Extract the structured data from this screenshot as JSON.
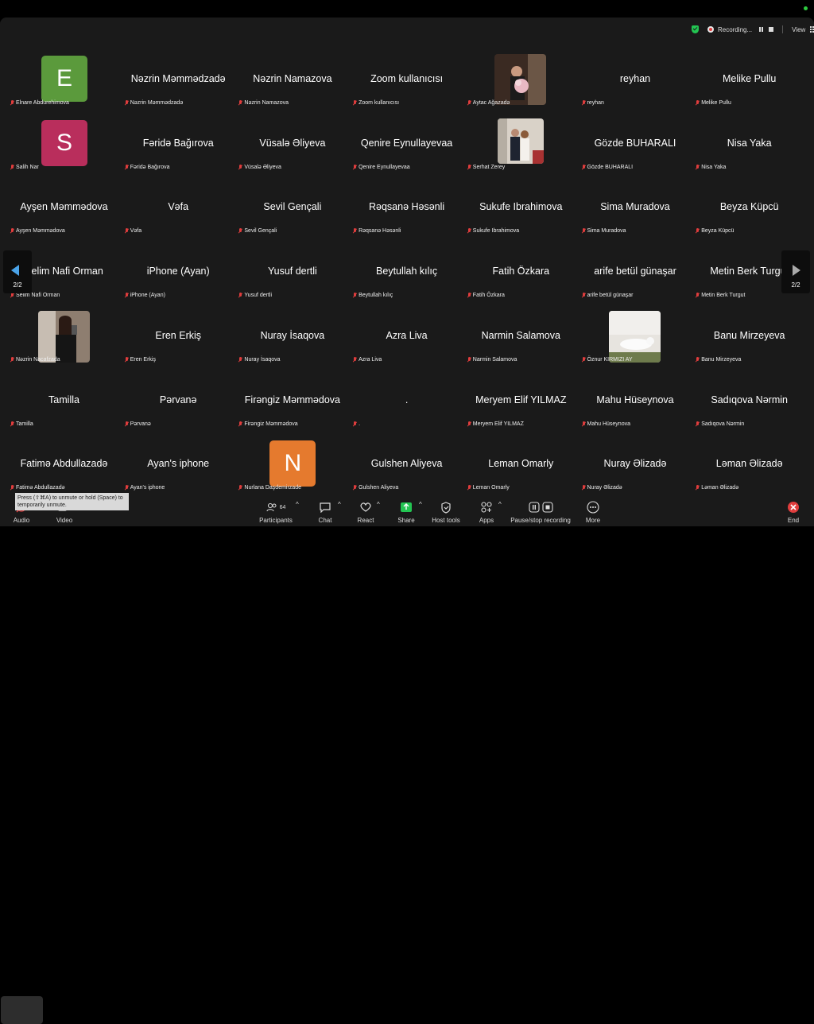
{
  "status": {
    "recording_label": "Recording...",
    "view_label": "View"
  },
  "gallery": {
    "rows": [
      [
        {
          "display": "",
          "tag": "Elnare Abdurehimova",
          "avatar": {
            "kind": "letter",
            "letter": "E",
            "color": "#5b9a3c"
          }
        },
        {
          "display": "Nəzrin Məmmədzadə",
          "tag": "Nəzrin Məmmədzadə"
        },
        {
          "display": "Nəzrin Namazova",
          "tag": "Nəzrin Namazova"
        },
        {
          "display": "Zoom kullanıcısı",
          "tag": "Zoom kullanıcısı"
        },
        {
          "display": "",
          "tag": "Aytac Ağazadə",
          "avatar": {
            "kind": "photo",
            "variant": "bouquet"
          }
        },
        {
          "display": "reyhan",
          "tag": "reyhan"
        },
        {
          "display": "Melike Pullu",
          "tag": "Melike Pullu"
        }
      ],
      [
        {
          "display": "",
          "tag": "Salih Nar",
          "avatar": {
            "kind": "letter",
            "letter": "S",
            "color": "#b92e5c"
          }
        },
        {
          "display": "Fəridə Bağırova",
          "tag": "Fəridə Bağırova"
        },
        {
          "display": "Vüsalə Əliyeva",
          "tag": "Vüsalə Əliyeva"
        },
        {
          "display": "Qenire Eynullayevaa",
          "tag": "Qenire Eynullayevaa"
        },
        {
          "display": "",
          "tag": "Serhat Zerey",
          "avatar": {
            "kind": "photo",
            "variant": "couple"
          }
        },
        {
          "display": "Gözde BUHARALI",
          "tag": "Gözde BUHARALI"
        },
        {
          "display": "Nisa Yaka",
          "tag": "Nisa Yaka"
        }
      ],
      [
        {
          "display": "Ayşen Məmmədova",
          "tag": "Ayşen Məmmədova"
        },
        {
          "display": "Vəfa",
          "tag": "Vəfa"
        },
        {
          "display": "Sevil Gençali",
          "tag": "Sevil Gençali"
        },
        {
          "display": "Rəqsanə Həsənli",
          "tag": "Rəqsanə Həsənli"
        },
        {
          "display": "Sukufe Ibrahimova",
          "tag": "Sukufe Ibrahimova"
        },
        {
          "display": "Sima Muradova",
          "tag": "Sima Muradova"
        },
        {
          "display": "Beyza Küpcü",
          "tag": "Beyza Küpcü"
        }
      ],
      [
        {
          "display": "Selim Nafi Orman",
          "tag": "Selim Nafi Orman"
        },
        {
          "display": "iPhone (Ayan)",
          "tag": "iPhone (Ayan)"
        },
        {
          "display": "Yusuf dertli",
          "tag": "Yusuf dertli"
        },
        {
          "display": "Beytullah kılıç",
          "tag": "Beytullah kılıç"
        },
        {
          "display": "Fatih Özkara",
          "tag": "Fatih Özkara"
        },
        {
          "display": "arife betül günaşar",
          "tag": "arife betül günaşar"
        },
        {
          "display": "Metin Berk Turgut",
          "tag": "Metin Berk Turgut"
        }
      ],
      [
        {
          "display": "",
          "tag": "Nəzrin Nacafzada",
          "avatar": {
            "kind": "photo",
            "variant": "selfie"
          }
        },
        {
          "display": "Eren Erkiş",
          "tag": "Eren Erkiş"
        },
        {
          "display": "Nuray İsaqova",
          "tag": "Nuray İsaqova"
        },
        {
          "display": "Azra Liva",
          "tag": "Azra Liva"
        },
        {
          "display": "Narmin Salamova",
          "tag": "Narmin Salamova"
        },
        {
          "display": "",
          "tag": "Öznur KIRMIZI AY",
          "avatar": {
            "kind": "photo",
            "variant": "cat"
          }
        },
        {
          "display": "Banu Mirzeyeva",
          "tag": "Banu Mirzeyeva"
        }
      ],
      [
        {
          "display": "Tamilla",
          "tag": "Tamilla"
        },
        {
          "display": "Pərvanə",
          "tag": "Pərvanə"
        },
        {
          "display": "Firəngiz Məmmədova",
          "tag": "Firəngiz Məmmədova"
        },
        {
          "display": ".",
          "tag": "."
        },
        {
          "display": "Meryem Elif YILMAZ",
          "tag": "Meryem Elif YILMAZ"
        },
        {
          "display": "Mahu Hüseynova",
          "tag": "Mahu Hüseynova"
        },
        {
          "display": "Sadıqova Nərmin",
          "tag": "Sadıqova Nərmin"
        }
      ],
      [
        {
          "display": "Fatimə Abdullazadə",
          "tag": "Fatimə Abdullazadə"
        },
        {
          "display": "Ayan's iphone",
          "tag": "Ayan's iphone"
        },
        {
          "display": "",
          "tag": "Nurlana Daşdemirzade",
          "avatar": {
            "kind": "letter",
            "letter": "N",
            "color": "#e57a2e"
          }
        },
        {
          "display": "Gulshen  Aliyeva",
          "tag": "Gulshen  Aliyeva"
        },
        {
          "display": "Leman Omarly",
          "tag": "Leman Omarly"
        },
        {
          "display": "Nuray Əlizadə",
          "tag": "Nuray Əlizadə"
        },
        {
          "display": "Ləman Əlizadə",
          "tag": "Ləman Əlizadə"
        }
      ]
    ]
  },
  "pager": {
    "left_count": "2/2",
    "right_count": "2/2"
  },
  "tooltip": "Press (⇧⌘A) to unmute or hold (Space) to temporarily unmute.",
  "toolbar": {
    "audio": "Audio",
    "video": "Video",
    "participants": "Participants",
    "participants_count": "64",
    "chat": "Chat",
    "react": "React",
    "share": "Share",
    "host_tools": "Host tools",
    "apps": "Apps",
    "record": "Pause/stop recording",
    "more": "More",
    "end": "End"
  },
  "colors": {
    "accent": "#4aa3e8",
    "muted_red": "#e03d3d",
    "share_green": "#23c552"
  }
}
